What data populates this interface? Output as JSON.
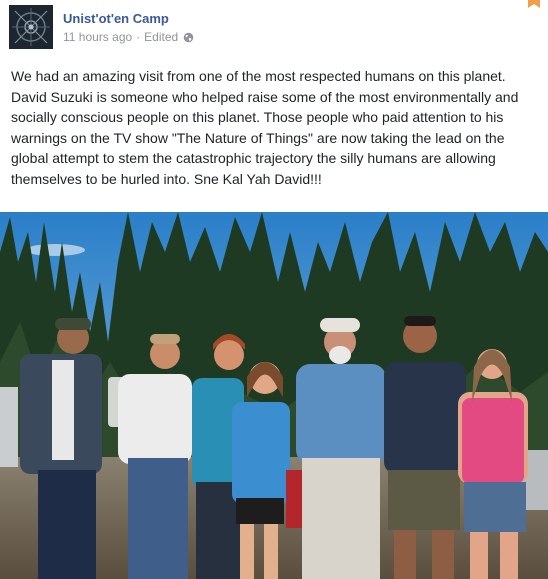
{
  "post": {
    "author": "Unist'ot'en Camp",
    "time": "11 hours ago",
    "separator": "·",
    "edited": "Edited",
    "audience_icon": "globe-icon",
    "body": "We had an amazing visit from one of the most respected humans on this planet. David Suzuki is someone who helped raise some of the most environmentally and socially conscious people on this planet. Those people who paid attention to his warnings on the TV show \"The Nature of Things\" are now taking the lead on the global attempt to stem the catastrophic trajectory the silly humans are allowing themselves to be hurled into. Sne Kal Yah David!!!"
  },
  "colors": {
    "author_link": "#3b5998",
    "meta_text": "#90949c",
    "body_text": "#1d2129",
    "ribbon": "#f0a04b"
  }
}
